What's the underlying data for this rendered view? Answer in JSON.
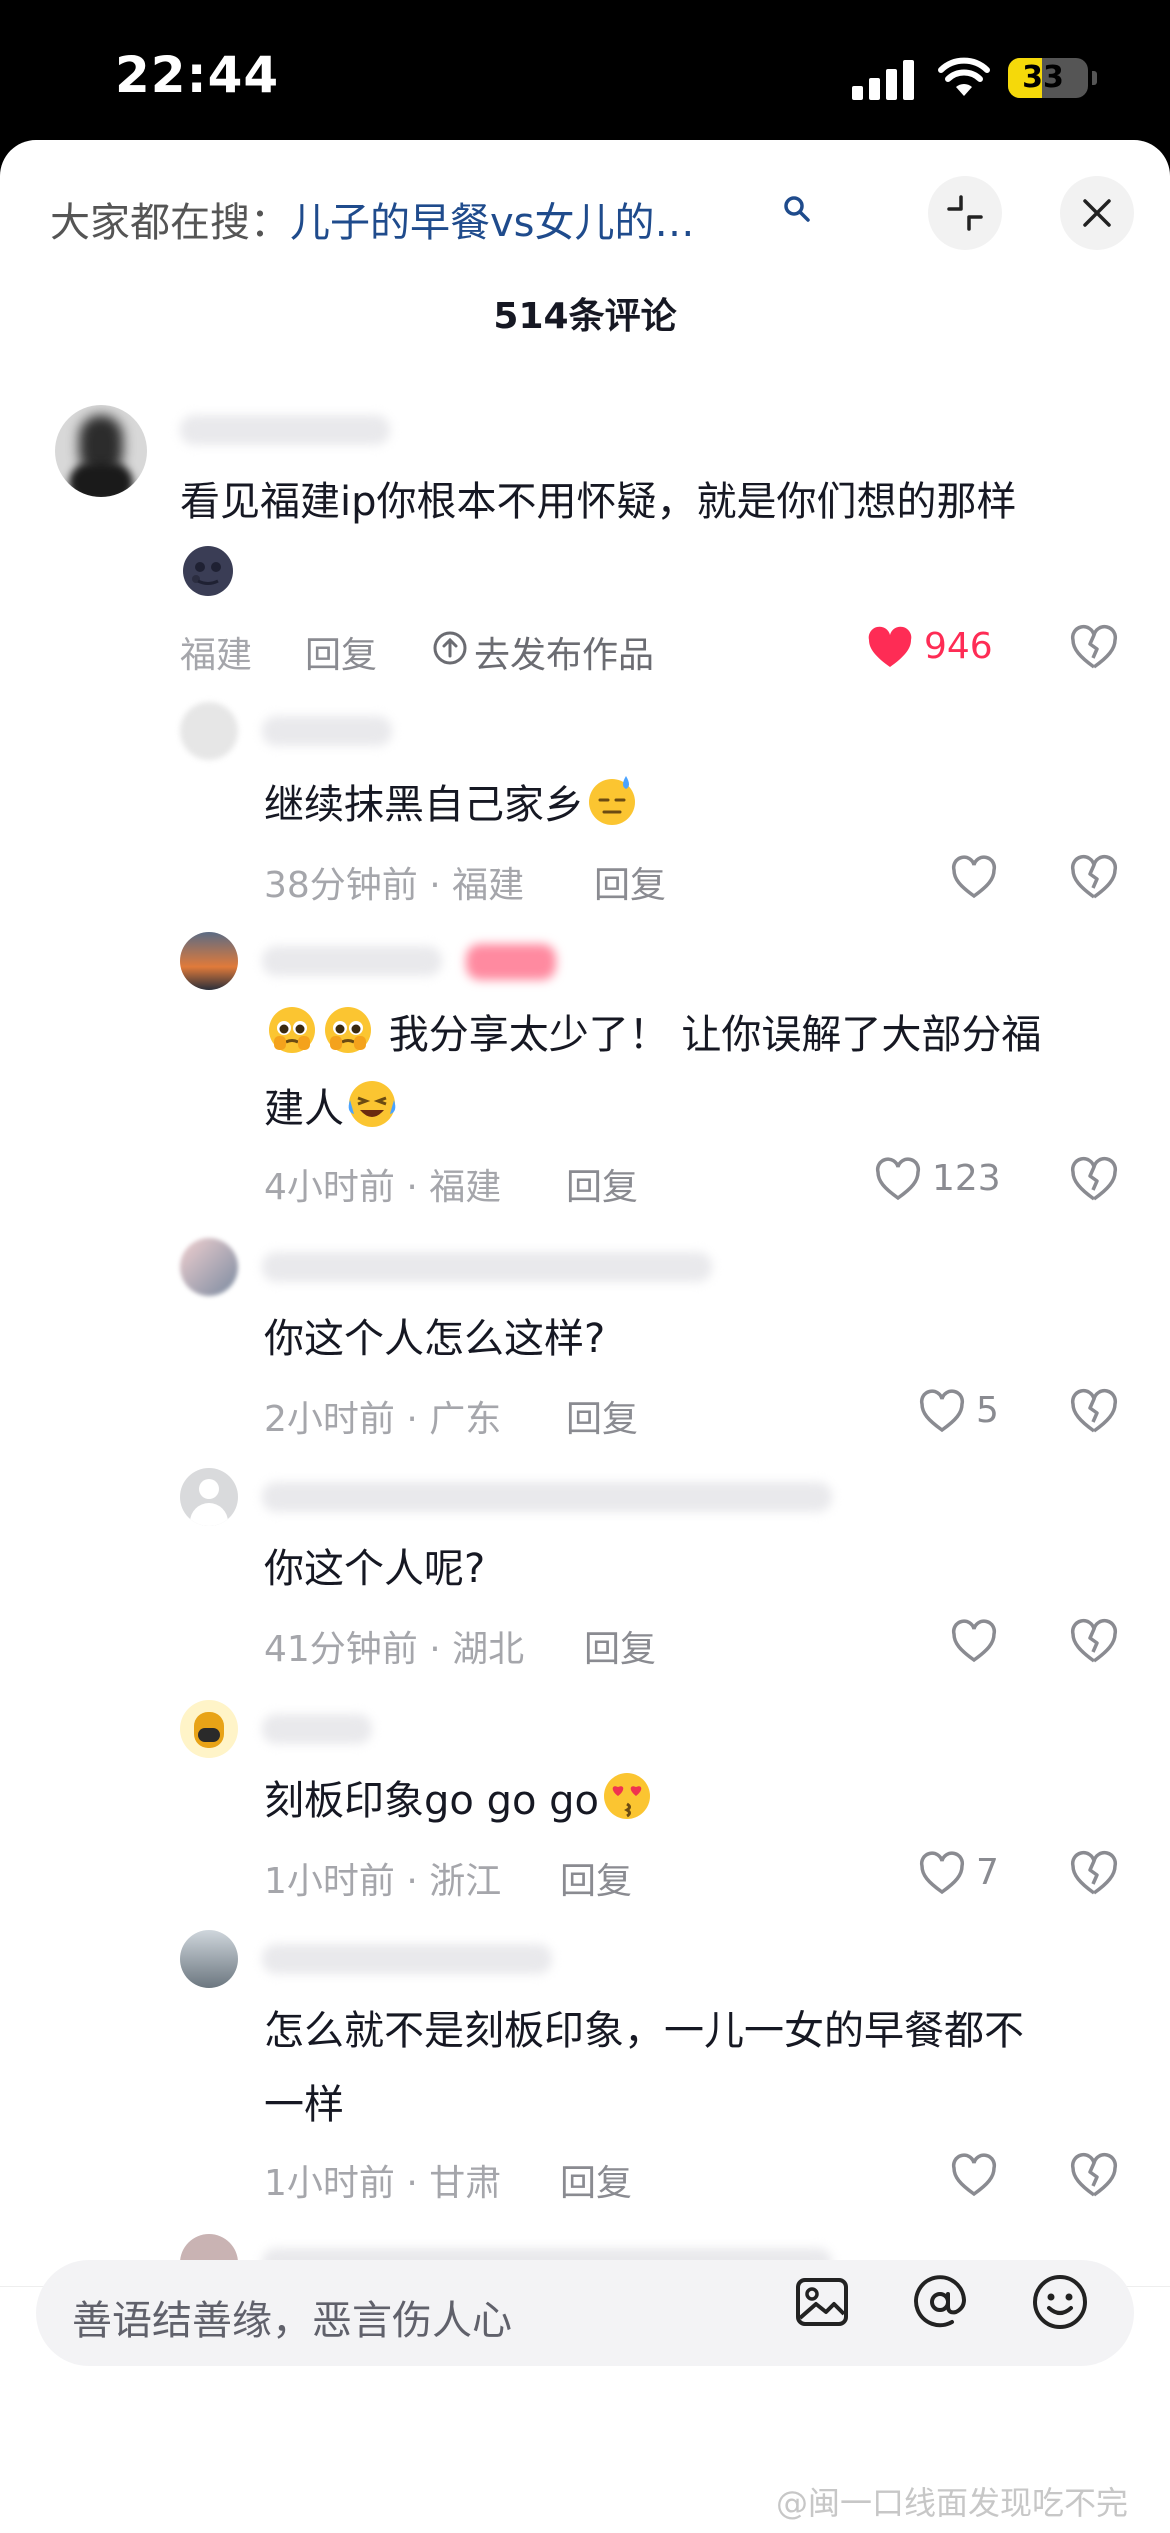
{
  "status": {
    "time": "22:44",
    "battery": "33"
  },
  "header": {
    "search_prefix": "大家都在搜：",
    "search_query": "儿子的早餐vs女儿的…",
    "comment_count": "514条评论"
  },
  "comments": [
    {
      "text": "看见福建ip你根本不用怀疑，就是你们想的那样",
      "meta": "福建",
      "reply": "回复",
      "publish": "去发布作品",
      "likes": "946"
    },
    {
      "text": "继续抹黑自己家乡",
      "meta": "38分钟前 · 福建",
      "reply": "回复",
      "likes": ""
    },
    {
      "text_line1": "我分享太少了！ 让你误解了大部分福",
      "text_line2": "建人",
      "meta": "4小时前 · 福建",
      "reply": "回复",
      "likes": "123"
    },
    {
      "text": "你这个人怎么这样?",
      "meta": "2小时前 · 广东",
      "reply": "回复",
      "likes": "5"
    },
    {
      "text": "你这个人呢?",
      "meta": "41分钟前 · 湖北",
      "reply": "回复",
      "likes": ""
    },
    {
      "text": "刻板印象go go go",
      "meta": "1小时前 · 浙江",
      "reply": "回复",
      "likes": "7"
    },
    {
      "text_line1": "怎么就不是刻板印象，一儿一女的早餐都不",
      "text_line2": "一样",
      "meta": "1小时前 · 甘肃",
      "reply": "回复",
      "likes": ""
    }
  ],
  "input": {
    "placeholder": "善语结善缘，恶言伤人心"
  },
  "watermark": "@闽一口线面发现吃不完"
}
